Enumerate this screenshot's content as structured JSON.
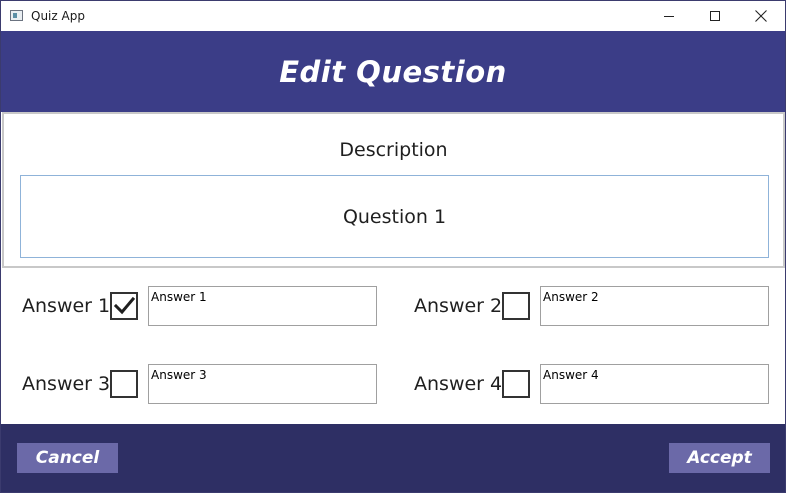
{
  "window": {
    "title": "Quiz App"
  },
  "header": {
    "title": "Edit Question"
  },
  "question": {
    "description_label": "Description",
    "text": "Question 1"
  },
  "answers": [
    {
      "label": "Answer 1",
      "value": "Answer 1",
      "correct": true
    },
    {
      "label": "Answer 2",
      "value": "Answer 2",
      "correct": false
    },
    {
      "label": "Answer 3",
      "value": "Answer 3",
      "correct": false
    },
    {
      "label": "Answer 4",
      "value": "Answer 4",
      "correct": false
    }
  ],
  "footer": {
    "cancel_label": "Cancel",
    "accept_label": "Accept"
  },
  "colors": {
    "header_bg": "#3b3d87",
    "footer_bg": "#2e2f64",
    "button_bg": "#6b69a8"
  },
  "icons": {
    "app": "app-window-icon",
    "minimize": "minimize-icon",
    "maximize": "maximize-icon",
    "close": "close-icon",
    "check": "checkmark-icon"
  }
}
